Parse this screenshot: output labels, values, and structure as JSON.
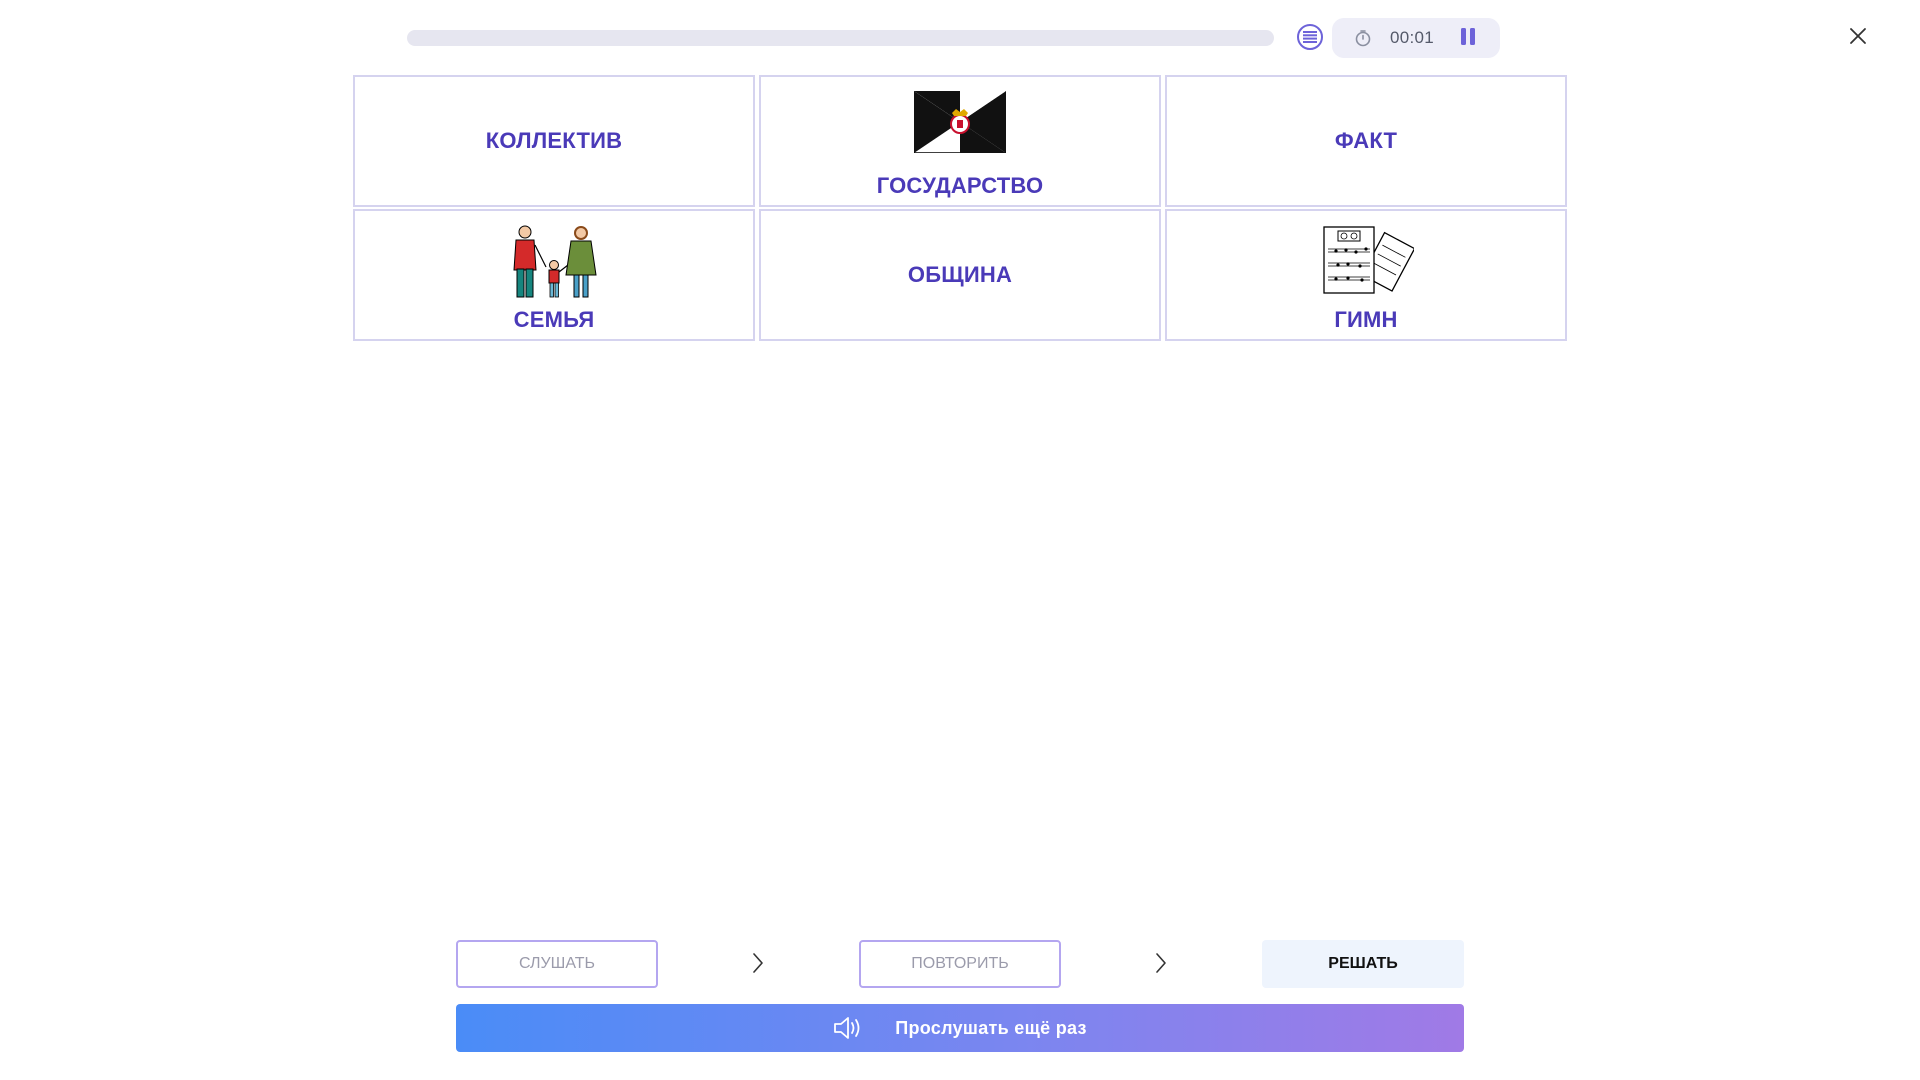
{
  "header": {
    "progress_fraction": 0,
    "list_icon": "list-icon",
    "timer_icon": "stopwatch-icon",
    "timer": "00:01",
    "pause_icon": "pause-icon",
    "close_icon": "close-icon"
  },
  "cards": [
    {
      "label": "КОЛЛЕКТИВ",
      "image": null
    },
    {
      "label": "ГОСУДАРСТВО",
      "image": "flag-image"
    },
    {
      "label": "ФАКТ",
      "image": null
    },
    {
      "label": "СЕМЬЯ",
      "image": "family-image"
    },
    {
      "label": "ОБЩИНА",
      "image": null
    },
    {
      "label": "ГИМН",
      "image": "sheet-music-image"
    }
  ],
  "steps": {
    "listen": "СЛУШАТЬ",
    "repeat": "ПОВТОРИТЬ",
    "solve": "РЕШАТЬ"
  },
  "replay": {
    "label": "Прослушать ещё раз",
    "icon": "speaker-icon"
  },
  "colors": {
    "accent": "#4a3ab8",
    "card_border": "#d5d3ef",
    "gradient_start": "#4a8cf7",
    "gradient_end": "#a07ae6"
  }
}
